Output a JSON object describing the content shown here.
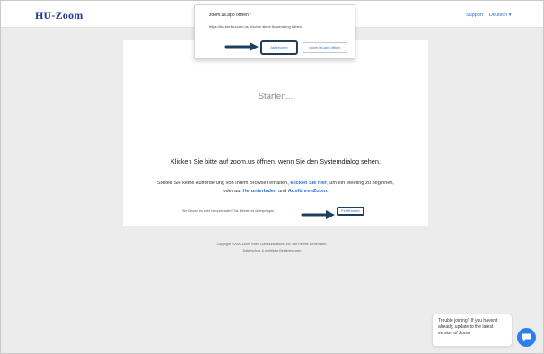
{
  "header": {
    "brand": "HU-Zoom",
    "support": "Support",
    "language": "Deutsch ▾"
  },
  "main": {
    "status": "Starten...",
    "headline": "Klicken Sie bitte auf zoom.us öffnen, wenn Sie den Systemdialog sehen.",
    "instruction_prefix": "Sollten Sie keine Aufforderung von Ihrem Browser erhalten,",
    "instruction_link_click": "klicken Sie hier",
    "instruction_mid": ", um ein Meeting zu beginnen,",
    "instruction_or": "oder auf",
    "instruction_link_download": "Herunterladen",
    "instruction_and": "und",
    "instruction_link_run": "AusführenZoom",
    "instruction_suffix": ".",
    "alt_text": "Sie können es nicht herunterladen? Sie können es überspringen",
    "join_browser": "Per Browser"
  },
  "footer": {
    "copyright": "Copyright ©2020 Zoom Video Communications, Inc. Alle Rechte vorbehalten.",
    "legal": "Datenschutz & rechtliche Bestimmungen"
  },
  "dialog": {
    "title": "zoom.us.app öffnen?",
    "message": "https://hu-berlin.zoom.us möchte diese Anwendung öffnen.",
    "cancel": "Abbrechen",
    "open": "zoom.us.app öffnen"
  },
  "chat": {
    "message": "Trouble joining? If you haven't already, update to the latest version of Zoom",
    "icon": "chat-bubble-icon"
  },
  "colors": {
    "brand": "#1f3a8f",
    "link": "#2d6fd6",
    "highlight_border": "#1e3f5c",
    "chat_button": "#2d7ff0",
    "page_background": "#ececec"
  }
}
